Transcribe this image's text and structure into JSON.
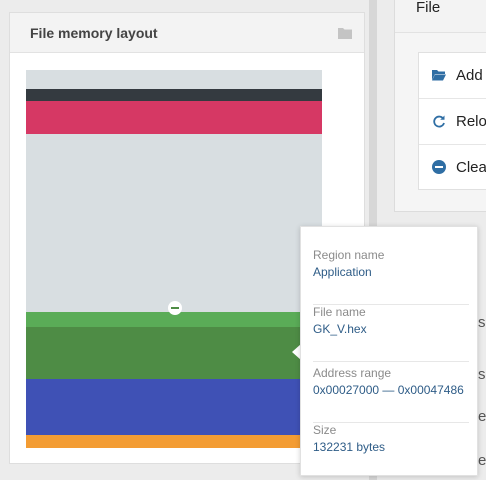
{
  "left_panel": {
    "title": "File memory layout",
    "header_icon": "folder-icon"
  },
  "memory_map": {
    "segments": [
      {
        "name": "free-space-top",
        "color": "#d8dee1"
      },
      {
        "name": "dark-region",
        "color": "#343a40"
      },
      {
        "name": "pink-region",
        "color": "#d63864"
      },
      {
        "name": "free-space-middle",
        "color": "#d8dee1"
      },
      {
        "name": "application-region-highlight",
        "color": "#5aac57"
      },
      {
        "name": "application-region",
        "color": "#4e8c45"
      },
      {
        "name": "blue-region",
        "color": "#3f51b5"
      },
      {
        "name": "orange-region",
        "color": "#f39c33"
      }
    ],
    "remove_icon": "minus-circle-icon"
  },
  "right_panel": {
    "title": "File",
    "buttons": [
      {
        "label": "Add",
        "icon": "folder-open-icon",
        "icon_color": "#2f6ea4"
      },
      {
        "label": "Relo",
        "icon": "reload-icon",
        "icon_color": "#2f6ea4"
      },
      {
        "label": "Clea",
        "icon": "minus-circle-icon",
        "icon_color": "#2f6ea4"
      }
    ],
    "cutoff_letters": [
      "s",
      "s",
      "e",
      "e"
    ]
  },
  "tooltip": {
    "rows": [
      {
        "label": "Region name",
        "value": "Application"
      },
      {
        "label": "File name",
        "value": "GK_V.hex"
      },
      {
        "label": "Address range",
        "value": "0x00027000 — 0x00047486"
      },
      {
        "label": "Size",
        "value": "132231 bytes"
      }
    ]
  }
}
